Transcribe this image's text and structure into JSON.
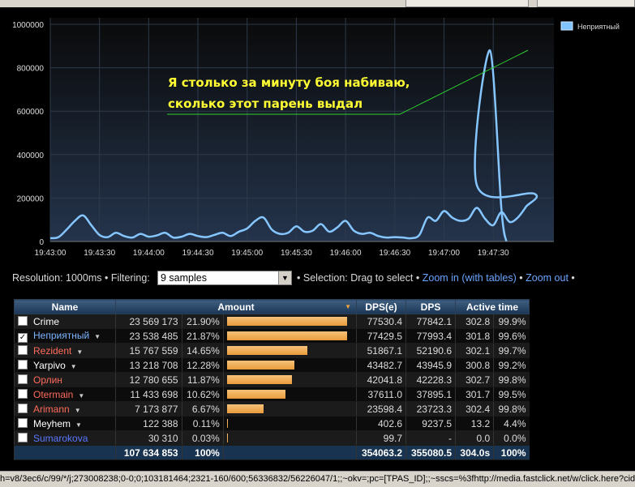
{
  "chart_data": {
    "type": "line",
    "title": "",
    "legend": [
      "Неприятный"
    ],
    "ylim": [
      0,
      1000000
    ],
    "y_ticks": [
      "0",
      "200000",
      "400000",
      "600000",
      "800000",
      "1000000"
    ],
    "x_ticks": [
      "19:43:00",
      "19:43:30",
      "19:44:00",
      "19:44:30",
      "19:45:00",
      "19:45:30",
      "19:46:00",
      "19:46:30",
      "19:47:00",
      "19:47:30"
    ],
    "x_seconds": [
      0,
      5,
      10,
      15,
      20,
      25,
      30,
      35,
      40,
      45,
      50,
      55,
      60,
      65,
      70,
      75,
      80,
      85,
      90,
      95,
      100,
      105,
      110,
      115,
      120,
      125,
      130,
      135,
      140,
      145,
      150,
      155,
      160,
      165,
      170,
      175,
      180,
      185,
      190,
      195,
      200,
      205,
      210,
      215,
      220,
      225,
      230,
      235,
      240,
      245,
      250,
      255,
      260,
      265,
      270,
      275,
      280,
      285,
      290,
      295
    ],
    "series": [
      {
        "name": "Неприятный",
        "color": "#86c6ff",
        "values": [
          15000,
          20000,
          55000,
          95000,
          120000,
          75000,
          30000,
          20000,
          40000,
          25000,
          18000,
          35000,
          22000,
          28000,
          40000,
          18000,
          22000,
          35000,
          25000,
          20000,
          30000,
          40000,
          25000,
          45000,
          60000,
          95000,
          110000,
          55000,
          35000,
          40000,
          70000,
          45000,
          50000,
          80000,
          45000,
          65000,
          95000,
          50000,
          35000,
          40000,
          25000,
          18000,
          20000,
          18000,
          15000,
          30000,
          110000,
          95000,
          140000,
          110000,
          95000,
          105000,
          155000,
          105000,
          75000,
          135000,
          90000,
          110000,
          160000,
          220000
        ]
      },
      {
        "name": "Неприятный",
        "values_tail": [
          {
            "t": 260,
            "v": 260000
          },
          {
            "t": 268,
            "v": 880000
          },
          {
            "t": 275,
            "v": 150000
          },
          {
            "t": 278,
            "v": 0
          }
        ]
      }
    ],
    "annotation": {
      "line1": "Я столько за минуту боя набиваю,",
      "line2": "сколько этот парень выдал"
    }
  },
  "controls": {
    "resolution": "Resolution: 1000ms",
    "filtering_label": "Filtering:",
    "filtering_value": "9 samples",
    "selection_text": "Selection: Drag to select",
    "zoom_in": "Zoom in (with tables)",
    "zoom_out": "Zoom out",
    "bullet": "•"
  },
  "table": {
    "headers": {
      "name": "Name",
      "amount": "Amount",
      "dpse": "DPS(e)",
      "dps": "DPS",
      "active": "Active time"
    },
    "rows": [
      {
        "name": "Crime",
        "color": "#ffffff",
        "checked": false,
        "dropdown": false,
        "amount": "23 569 173",
        "pct": "21.90%",
        "bar": 1.0,
        "dpse": "77530.4",
        "dps": "77842.1",
        "active": "302.8",
        "active_pct": "99.9%"
      },
      {
        "name": "Неприятный",
        "color": "#7ab4ff",
        "checked": true,
        "dropdown": true,
        "amount": "23 538 485",
        "pct": "21.87%",
        "bar": 0.9987,
        "dpse": "77429.5",
        "dps": "77993.4",
        "active": "301.8",
        "active_pct": "99.6%"
      },
      {
        "name": "Rezident",
        "color": "#ff6b5b",
        "checked": false,
        "dropdown": true,
        "amount": "15 767 559",
        "pct": "14.65%",
        "bar": 0.669,
        "dpse": "51867.1",
        "dps": "52190.6",
        "active": "302.1",
        "active_pct": "99.7%"
      },
      {
        "name": "Yarpivo",
        "color": "#ffffff",
        "checked": false,
        "dropdown": true,
        "amount": "13 218 708",
        "pct": "12.28%",
        "bar": 0.561,
        "dpse": "43482.7",
        "dps": "43945.9",
        "active": "300.8",
        "active_pct": "99.2%"
      },
      {
        "name": "Орлин",
        "color": "#ff6b5b",
        "checked": false,
        "dropdown": false,
        "amount": "12 780 655",
        "pct": "11.87%",
        "bar": 0.542,
        "dpse": "42041.8",
        "dps": "42228.3",
        "active": "302.7",
        "active_pct": "99.8%"
      },
      {
        "name": "Otermain",
        "color": "#ff6b5b",
        "checked": false,
        "dropdown": true,
        "amount": "11 433 698",
        "pct": "10.62%",
        "bar": 0.485,
        "dpse": "37611.0",
        "dps": "37895.1",
        "active": "301.7",
        "active_pct": "99.5%"
      },
      {
        "name": "Arimann",
        "color": "#ff6b5b",
        "checked": false,
        "dropdown": true,
        "amount": "7 173 877",
        "pct": "6.67%",
        "bar": 0.304,
        "dpse": "23598.4",
        "dps": "23723.3",
        "active": "302.4",
        "active_pct": "99.8%"
      },
      {
        "name": "Meyhem",
        "color": "#ffffff",
        "checked": false,
        "dropdown": true,
        "amount": "122 388",
        "pct": "0.11%",
        "bar": 0.005,
        "dpse": "402.6",
        "dps": "9237.5",
        "active": "13.2",
        "active_pct": "4.4%"
      },
      {
        "name": "Sumarokova",
        "color": "#5a78ff",
        "checked": false,
        "dropdown": false,
        "amount": "30 310",
        "pct": "0.03%",
        "bar": 0.0,
        "dpse": "99.7",
        "dps": "-",
        "active": "0.0",
        "active_pct": "0.0%"
      }
    ],
    "totals": {
      "amount": "107 634 853",
      "pct": "100%",
      "dpse": "354063.2",
      "dps": "355080.5",
      "active": "304.0s",
      "active_pct": "100%"
    }
  },
  "statusbar": {
    "text": "h=v8/3ec6/c/99/*/j;273008238;0-0;0;103181464;2321-160/600;56336832/56226047/1;;~okv=;pc=[TPAS_ID];;~sscs=%3fhttp://media.fastclick.net/w/click.here?cid=49"
  }
}
